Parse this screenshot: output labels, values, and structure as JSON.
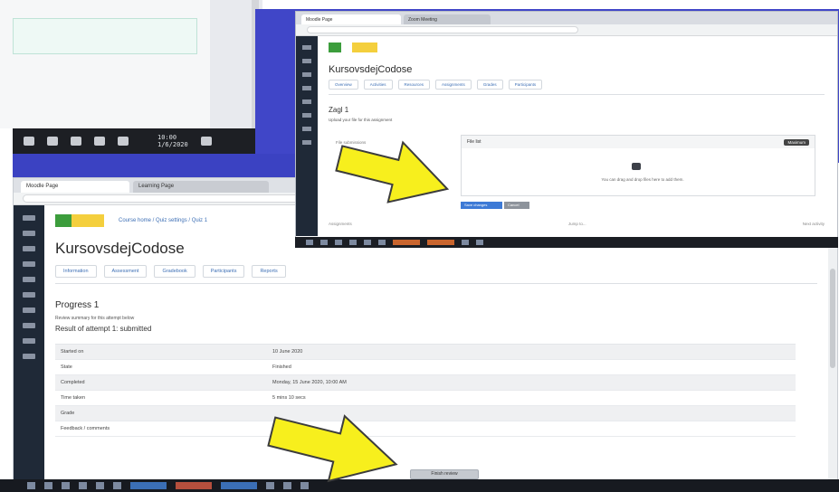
{
  "meeting_toolbar": {
    "time": "10:00",
    "date": "1/6/2020"
  },
  "back_window": {
    "tab_label": "Moodle Page",
    "tab2_label": "Learning Page",
    "course_title": "KursovsdejCodose",
    "breadcrumb": "Course home / Quiz settings / Quiz 1",
    "nav_tabs": [
      "Information",
      "Assessment",
      "Gradebook",
      "Participants",
      "Reports"
    ],
    "section_title": "Progress 1",
    "sub_text": "Review summary for this attempt below",
    "state_line": "Result of attempt 1: submitted",
    "rows": [
      {
        "label": "Started on",
        "value": "10 June 2020"
      },
      {
        "label": "State",
        "value": "Finished"
      },
      {
        "label": "Completed",
        "value": "Monday, 15 June 2020, 10:00 AM"
      },
      {
        "label": "Time taken",
        "value": "5 mins 10 secs"
      },
      {
        "label": "Grade",
        "value": ""
      },
      {
        "label": "Feedback / comments",
        "value": ""
      }
    ],
    "submit_label": "Finish review"
  },
  "front_window": {
    "tab_label": "Moodle Page",
    "tab2_label": "Zoom Meeting",
    "course_title": "KursovsdejCodose",
    "nav_tabs": [
      "Overview",
      "Activities",
      "Resources",
      "Assignments",
      "Grades",
      "Participants"
    ],
    "section_title": "Zagl 1",
    "sub_text": "Upload your file for this assignment",
    "left_label": "File submissions",
    "box_header_left": "File list",
    "box_header_badge": "Maximum",
    "box_drop_text": "You can drag and drop files here to add them.",
    "primary_button": "Save changes",
    "secondary_button": "Cancel",
    "footer_left": "Assignments",
    "footer_mid": "Jump to...",
    "footer_right": "Next activity"
  }
}
